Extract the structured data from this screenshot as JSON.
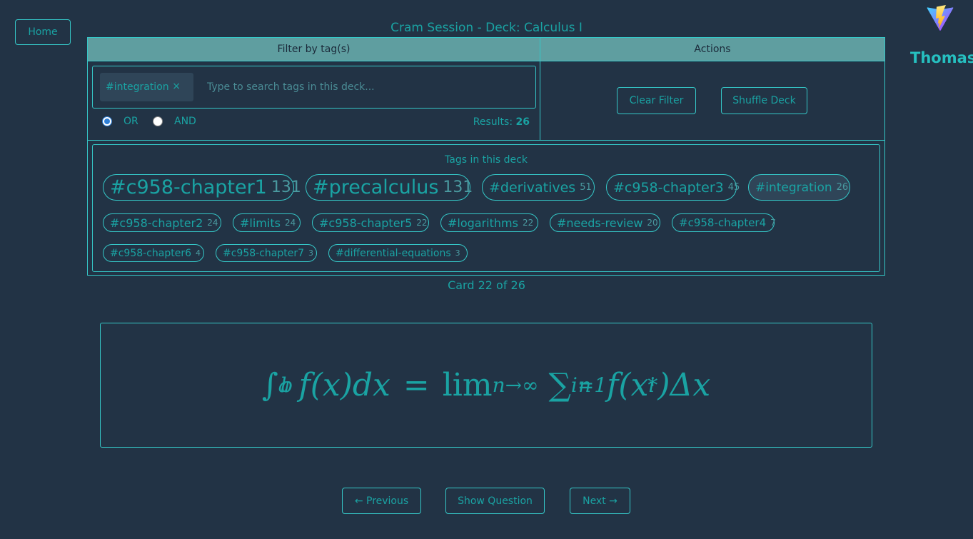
{
  "nav": {
    "home_label": "Home"
  },
  "page_title": "Cram Session - Deck: Calculus I",
  "user": {
    "name": "Thomas"
  },
  "filter": {
    "header": "Filter by tag(s)",
    "selected_tag": "#integration",
    "remove_symbol": "×",
    "search_placeholder": "Type to search tags in this deck...",
    "mode_or": "OR",
    "mode_and": "AND",
    "results_label": "Results:",
    "results_count": "26"
  },
  "actions": {
    "header": "Actions",
    "clear_label": "Clear Filter",
    "shuffle_label": "Shuffle Deck"
  },
  "tags_section": {
    "title": "Tags in this deck",
    "tags": [
      {
        "name": "#c958-chapter1",
        "count": "131"
      },
      {
        "name": "#precalculus",
        "count": "131"
      },
      {
        "name": "#derivatives",
        "count": "51"
      },
      {
        "name": "#c958-chapter3",
        "count": "45"
      },
      {
        "name": "#integration",
        "count": "26"
      },
      {
        "name": "#c958-chapter2",
        "count": "24"
      },
      {
        "name": "#limits",
        "count": "24"
      },
      {
        "name": "#c958-chapter5",
        "count": "22"
      },
      {
        "name": "#logarithms",
        "count": "22"
      },
      {
        "name": "#needs-review",
        "count": "20"
      },
      {
        "name": "#c958-chapter4",
        "count": "7"
      },
      {
        "name": "#c958-chapter6",
        "count": "4"
      },
      {
        "name": "#c958-chapter7",
        "count": "3"
      },
      {
        "name": "#differential-equations",
        "count": "3"
      }
    ]
  },
  "card": {
    "counter": "Card 22 of 26",
    "formula": {
      "integral": "∫",
      "lower": "a",
      "upper": "b",
      "integrand": "f(x)dx",
      "equals": "=",
      "lim": "lim",
      "lim_sub": "n→∞",
      "sum": "∑",
      "sum_sub": "i=1",
      "sum_sup": "n",
      "fx": "f(x",
      "xsub": "i",
      "xsup": "*",
      "tail": ")Δx"
    }
  },
  "controls": {
    "prev_label": "← Previous",
    "show_label": "Show Question",
    "next_label": "Next →"
  },
  "colors": {
    "background": "#223345",
    "accent": "#1aa3a3",
    "border": "#35c8c8",
    "header_bg": "#5f9ea0"
  }
}
